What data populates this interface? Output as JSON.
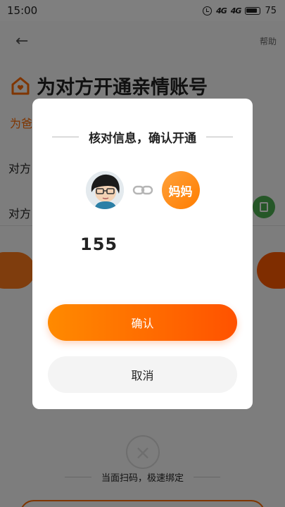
{
  "status_bar": {
    "time": "15:00",
    "signal_1": "4G",
    "signal_2": "4G",
    "battery": "75",
    "icons": [
      "alarm-icon",
      "signal-icon",
      "battery-icon"
    ]
  },
  "background": {
    "help": "帮助",
    "title": "为对方开通亲情账号",
    "subtitle": "为爸",
    "row1_label": "对方",
    "row2_label": "对方",
    "qr_hint": "当面扫码，极速绑定"
  },
  "dialog": {
    "title": "核对信息，确认开通",
    "mom_avatar_label": "妈妈",
    "phone": "155",
    "confirm_label": "确认",
    "cancel_label": "取消"
  },
  "colors": {
    "accent": "#ff6a00",
    "accent_light": "#ff8a00",
    "overlay": "rgba(0,0,0,0.5)"
  }
}
